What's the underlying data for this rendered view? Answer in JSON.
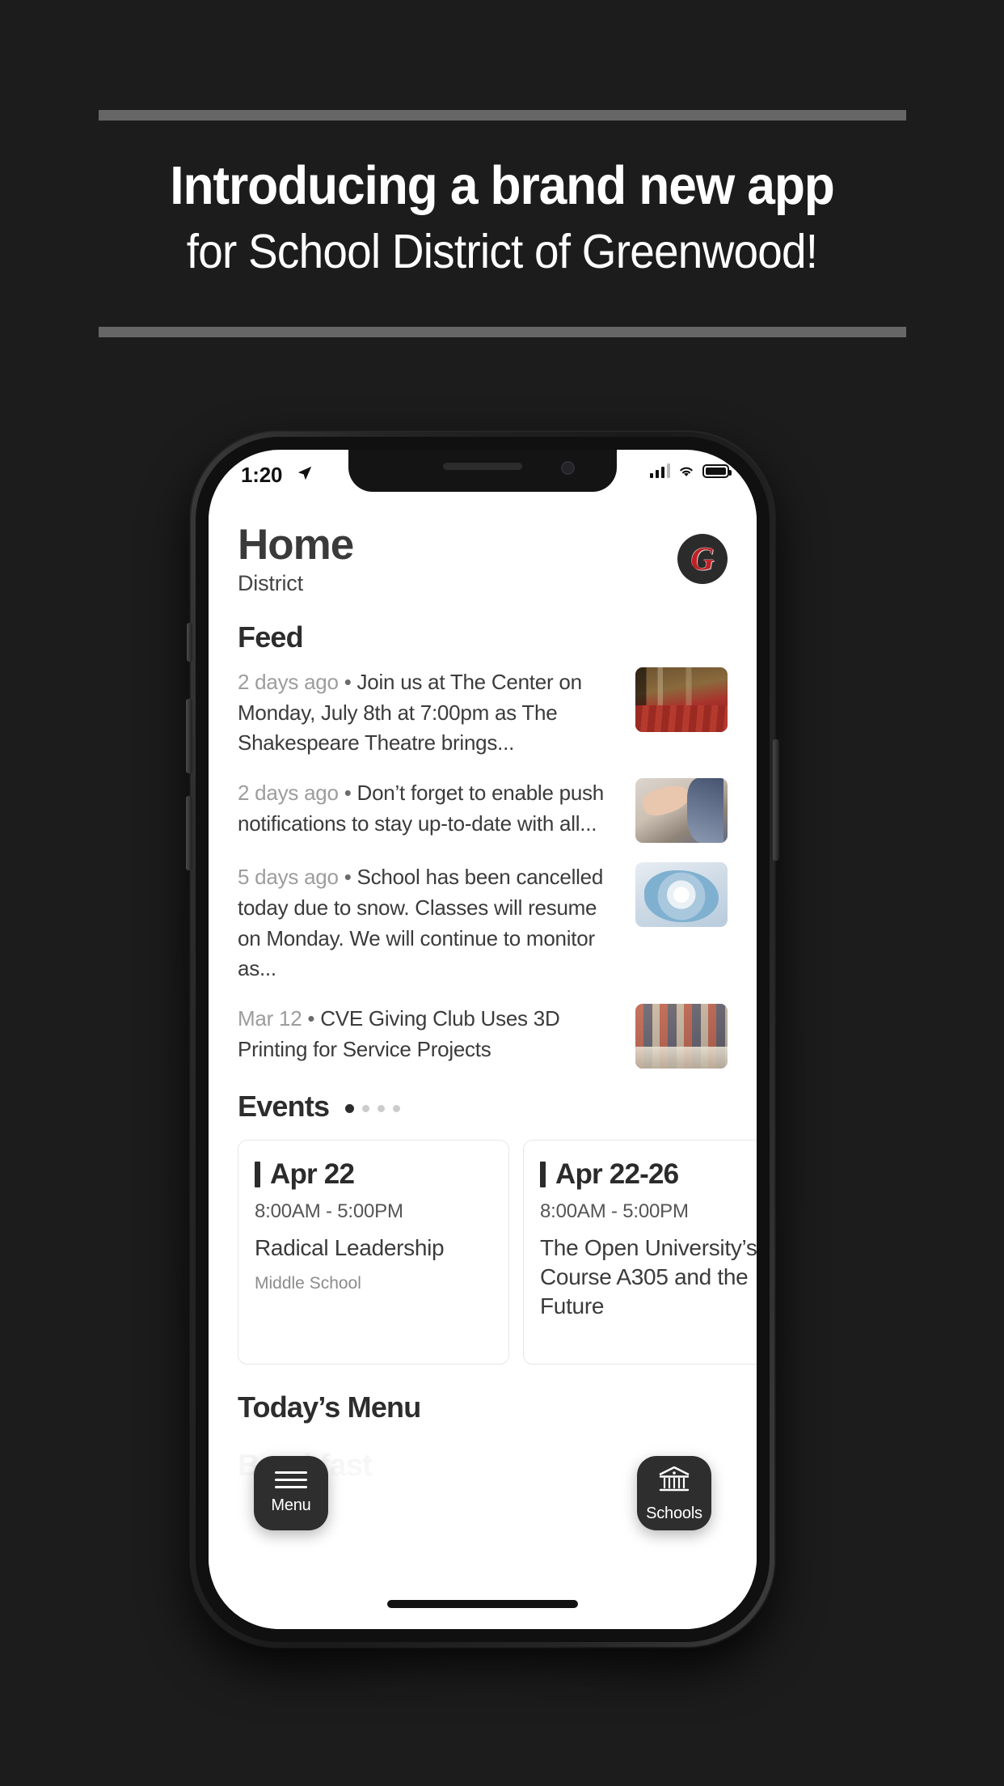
{
  "promo": {
    "line1": "Introducing a brand new app",
    "line2": "for School District of Greenwood!"
  },
  "phone": {
    "status_bar": {
      "time": "1:20",
      "location_icon": "location-arrow-icon",
      "signal_icon": "cellular-signal-icon",
      "wifi_icon": "wifi-icon",
      "battery_icon": "battery-icon"
    },
    "header": {
      "title": "Home",
      "subtitle": "District",
      "avatar_letter": "G"
    },
    "feed": {
      "section_title": "Feed",
      "items": [
        {
          "date": "2 days ago",
          "separator": "•",
          "text": "Join us at The Center on Monday, July 8th at 7:00pm as The Shakespeare Theatre brings...",
          "thumb": "theatre-seats-photo"
        },
        {
          "date": "2 days ago",
          "separator": "•",
          "text": "Don’t forget to enable push notifications to stay up-to-date with all...",
          "thumb": "phone-in-hand-photo"
        },
        {
          "date": "5 days ago",
          "separator": "•",
          "text": "School has been cancelled today due to snow. Classes will resume on Monday. We will continue to monitor as...",
          "thumb": "snowflake-mittens-photo"
        },
        {
          "date": "Mar 12",
          "separator": "•",
          "text": "CVE Giving Club Uses 3D Printing for Service Projects",
          "thumb": "classroom-students-photo"
        }
      ]
    },
    "events": {
      "section_title": "Events",
      "page_dots": 4,
      "active_dot": 1,
      "cards": [
        {
          "date": "Apr 22",
          "time": "8:00AM  -  5:00PM",
          "name": "Radical Leadership",
          "location": "Middle School"
        },
        {
          "date": "Apr 22-26",
          "time": "8:00AM  -  5:00PM",
          "name": "The Open University’s Course A305 and the Future",
          "location": ""
        }
      ]
    },
    "menu": {
      "section_title": "Today’s Menu",
      "meal": "Breakfast"
    },
    "fabs": [
      {
        "label": "Menu",
        "icon": "hamburger-menu-icon"
      },
      {
        "label": "Schools",
        "icon": "school-building-icon"
      }
    ]
  },
  "colors": {
    "background": "#1c1c1c",
    "rule": "#666666",
    "accent_red": "#c02026",
    "fab": "#2e2e2e"
  }
}
